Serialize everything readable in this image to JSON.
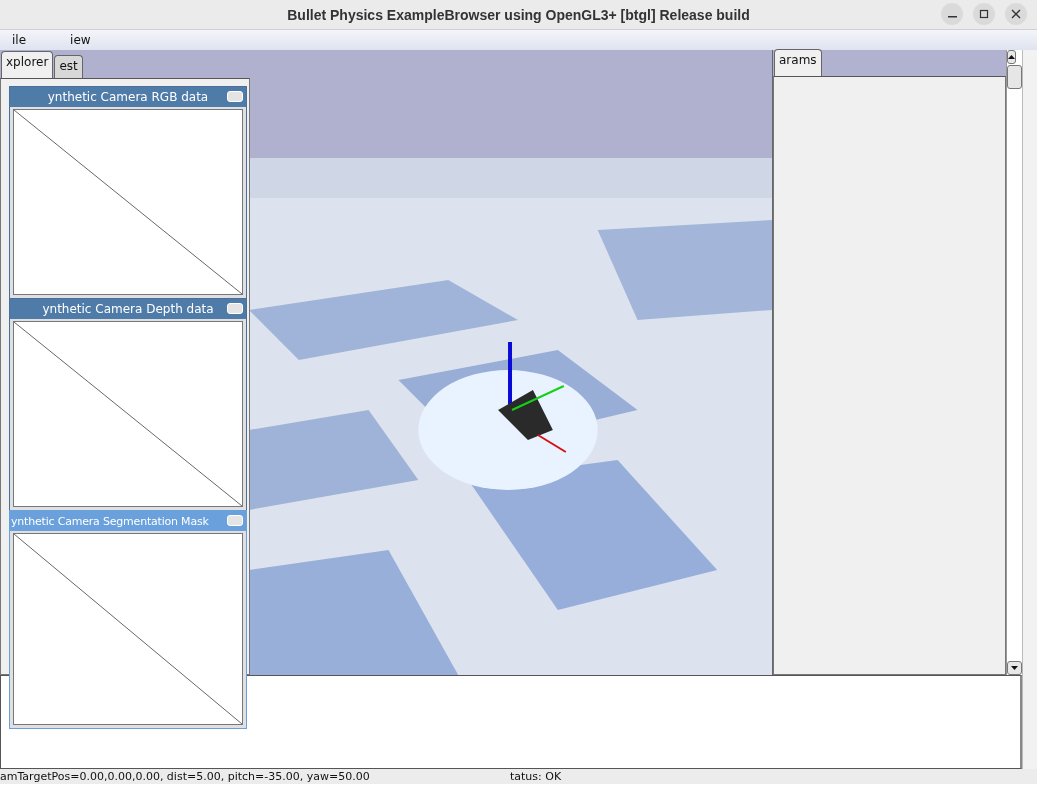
{
  "window": {
    "title": "Bullet Physics ExampleBrowser using OpenGL3+ [btgl] Release build"
  },
  "menu": [
    "ile",
    "iew"
  ],
  "left_tabs": [
    {
      "label": "xplorer",
      "selected": true
    },
    {
      "label": "est",
      "selected": false
    }
  ],
  "right_tabs": [
    {
      "label": "arams",
      "selected": true
    }
  ],
  "camera_windows": [
    {
      "title": "ynthetic Camera RGB data",
      "focused": false
    },
    {
      "title": "ynthetic Camera Depth data",
      "focused": false
    },
    {
      "title": "ynthetic Camera Segmentation Mask",
      "focused": true
    }
  ],
  "status_bar": {
    "camera": "amTargetPos=0.00,0.00,0.00, dist=5.00, pitch=-35.00, yaw=50.00",
    "status": "tatus: OK"
  }
}
